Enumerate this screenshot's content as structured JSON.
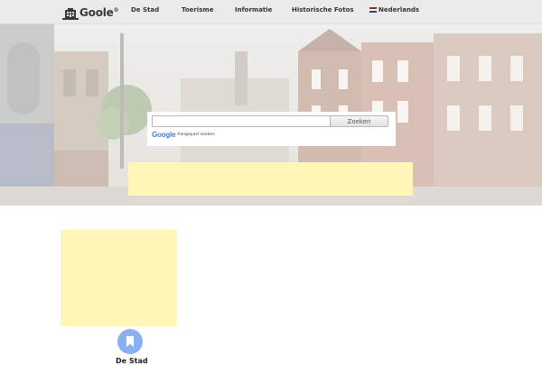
{
  "header": {
    "logo_text": "Goole",
    "logo_mark": "®",
    "nav": [
      {
        "label": "De Stad"
      },
      {
        "label": "Toerisme"
      },
      {
        "label": "Informatie"
      },
      {
        "label": "Historische Fotos"
      },
      {
        "label": "Nederlands",
        "icon": "dutch-flag-icon"
      }
    ]
  },
  "search": {
    "input_value": "",
    "input_placeholder": "",
    "button_label": "Zoeken",
    "powered_brand": "Google",
    "powered_text": "Aangepast zoeken"
  },
  "content": {
    "section_title": "De Stad",
    "bookmark_icon": "bookmark-icon"
  },
  "colors": {
    "header_bg": "#ebebeb",
    "ad_placeholder": "#fff6b8",
    "accent_blue": "#89b1f0",
    "flag": [
      "#ae1c28",
      "#ffffff",
      "#21468b"
    ]
  }
}
